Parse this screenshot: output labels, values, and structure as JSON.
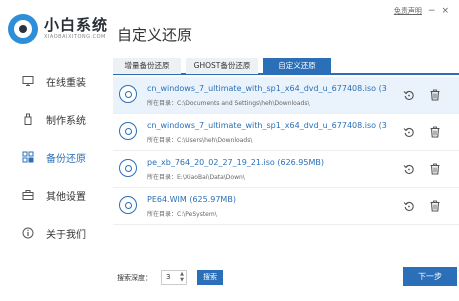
{
  "app": {
    "logo_title": "小白系统",
    "logo_subtitle": "XIAOBAIXITONG.COM"
  },
  "top_bar": {
    "disclaimer_link": "免责声明",
    "minimize": "−",
    "close": "×"
  },
  "sidebar": {
    "items": [
      {
        "label": "在线重装",
        "icon": "monitor-icon"
      },
      {
        "label": "制作系统",
        "icon": "usb-icon"
      },
      {
        "label": "备份还原",
        "icon": "grid-icon",
        "active": true
      },
      {
        "label": "其他设置",
        "icon": "briefcase-icon"
      },
      {
        "label": "关于我们",
        "icon": "info-icon"
      }
    ]
  },
  "main": {
    "title": "自定义还原",
    "tabs": [
      {
        "label": "增量备份还原"
      },
      {
        "label": "GHOST备份还原"
      },
      {
        "label": "自定义还原",
        "active": true
      }
    ],
    "files": [
      {
        "name": "cn_windows_7_ultimate_with_sp1_x64_dvd_u_677408.iso (3...",
        "dir_label": "所在目录：",
        "dir": "C:\\Documents and Settings\\heh\\Downloads\\",
        "selected": true
      },
      {
        "name": "cn_windows_7_ultimate_with_sp1_x64_dvd_u_677408.iso (3...",
        "dir_label": "所在目录：",
        "dir": "C:\\Users\\heh\\Downloads\\",
        "selected": false
      },
      {
        "name": "pe_xb_764_20_02_27_19_21.iso (626.95MB)",
        "dir_label": "所在目录：",
        "dir": "E:\\XiaoBai\\Data\\Down\\",
        "selected": false
      },
      {
        "name": "PE64.WIM (625.97MB)",
        "dir_label": "所在目录：",
        "dir": "C:\\PeSystem\\",
        "selected": false
      }
    ]
  },
  "footer": {
    "depth_label": "搜索深度：",
    "depth_value": "3",
    "search_button": "搜索",
    "next_button": "下一步"
  },
  "colors": {
    "accent": "#2a6fb8",
    "selected_row": "#eaf3fb"
  }
}
